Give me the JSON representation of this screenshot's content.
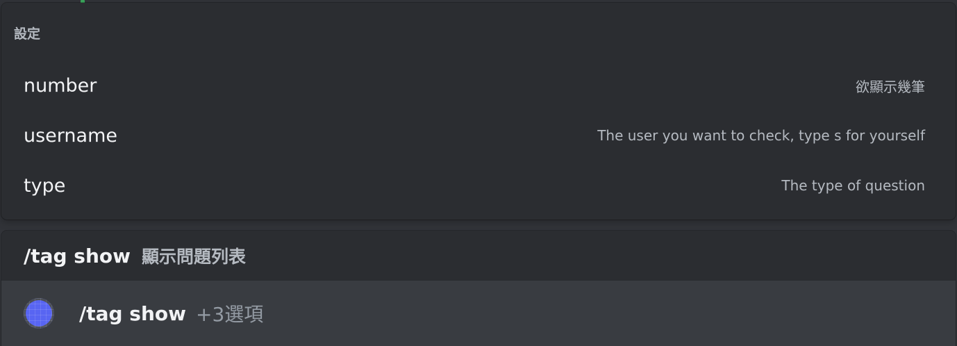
{
  "options_panel": {
    "header": "設定",
    "options": [
      {
        "name": "number",
        "description": "欲顯示幾筆"
      },
      {
        "name": "username",
        "description": "The user you want to check, type s for yourself"
      },
      {
        "name": "type",
        "description": "The type of question"
      }
    ]
  },
  "command_panel": {
    "command_name": "/tag show",
    "command_description": "顯示問題列表",
    "row": {
      "avatar_icon": "app-avatar-icon",
      "command_label": "/tag show",
      "extra_options": "+3選項"
    }
  },
  "colors": {
    "panel_bg": "#2b2d31",
    "selected_row_bg": "#393c41",
    "primary_text": "#f2f3f5",
    "secondary_text": "#b5bac1",
    "avatar": "#5865f2"
  }
}
